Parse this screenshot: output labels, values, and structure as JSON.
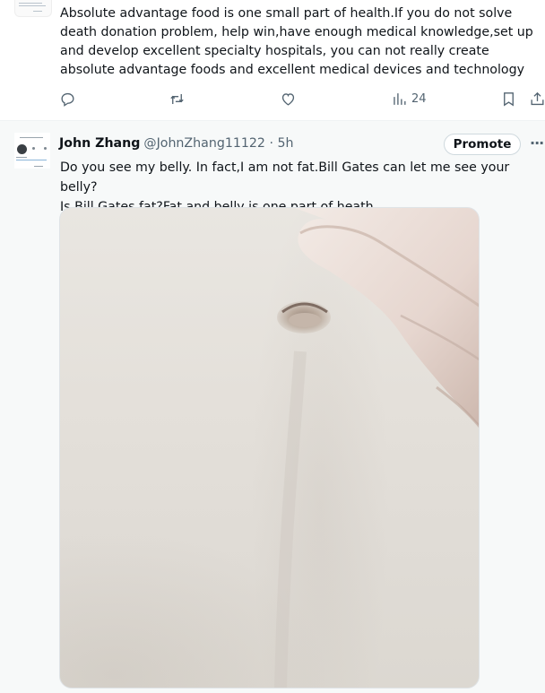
{
  "tweet_top": {
    "text": "Absolute advantage food is one small part of health.If you do not solve death donation problem, help win,have enough medical knowledge,set up and develop excellent specialty hospitals, you can not really create absolute advantage foods and excellent medical devices and technology",
    "views": "24"
  },
  "tweet": {
    "author_name": "John Zhang",
    "handle_time": "@JohnZhang11122 · 5h",
    "promote_label": "Promote",
    "more_label": "···",
    "line1": "Do you see my belly. In fact,I am not fat.Bill Gates can let me see your belly?",
    "line2": "Is Bill Gates fat?Fat and belly is one part of heath."
  },
  "icons": {
    "reply": "reply-icon",
    "retweet": "retweet-icon",
    "like": "heart-icon",
    "views": "views-icon",
    "bookmark": "bookmark-icon",
    "share": "share-icon"
  }
}
